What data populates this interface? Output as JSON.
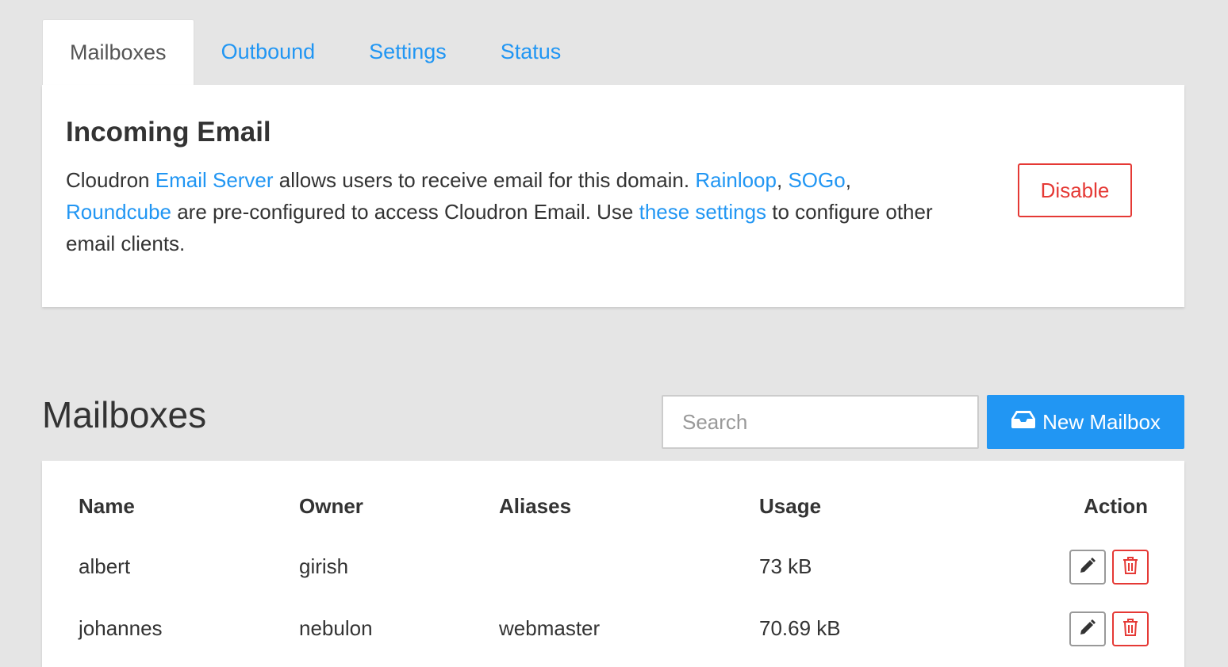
{
  "tabs": [
    {
      "label": "Mailboxes"
    },
    {
      "label": "Outbound"
    },
    {
      "label": "Settings"
    },
    {
      "label": "Status"
    }
  ],
  "incoming": {
    "title": "Incoming Email",
    "text_1": "Cloudron ",
    "link_email_server": "Email Server",
    "text_2": " allows users to receive email for this domain. ",
    "link_rainloop": "Rainloop",
    "text_3": ", ",
    "link_sogo": "SOGo",
    "text_4": ", ",
    "link_roundcube": "Roundcube",
    "text_5": " are pre-configured to access Cloudron Email. Use ",
    "link_settings": "these settings",
    "text_6": " to configure other email clients.",
    "disable_label": "Disable"
  },
  "mailboxes": {
    "title": "Mailboxes",
    "search_placeholder": "Search",
    "new_label": "New Mailbox",
    "columns": {
      "name": "Name",
      "owner": "Owner",
      "aliases": "Aliases",
      "usage": "Usage",
      "action": "Action"
    },
    "rows": [
      {
        "name": "albert",
        "owner": "girish",
        "aliases": "",
        "usage": "73 kB"
      },
      {
        "name": "johannes",
        "owner": "nebulon",
        "aliases": "webmaster",
        "usage": "70.69 kB"
      }
    ]
  },
  "colors": {
    "accent": "#2196f3",
    "danger": "#e53935",
    "background": "#e5e5e5"
  },
  "icons": {
    "new_mailbox": "inbox-icon",
    "edit": "pencil-icon",
    "delete": "trash-icon"
  }
}
